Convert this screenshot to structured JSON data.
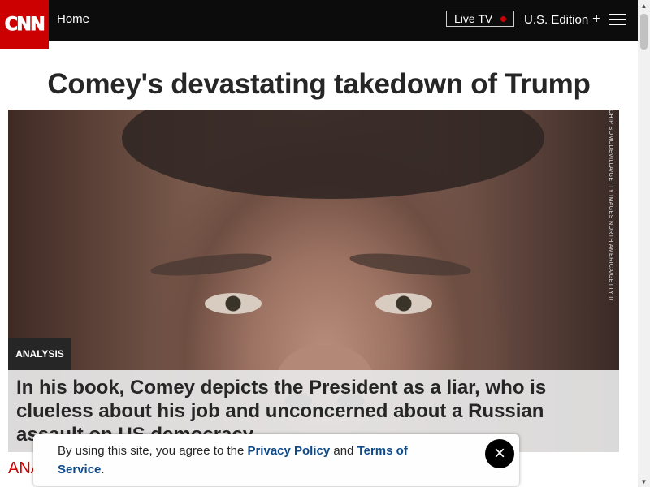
{
  "header": {
    "logo_text": "CNN",
    "nav_home": "Home",
    "live_tv": "Live TV",
    "edition": "U.S. Edition",
    "edition_icon": "+",
    "menu_icon": "hamburger-menu-icon"
  },
  "article": {
    "headline": "Comey's devastating takedown of Trump",
    "image_credit": "CHIP SOMODEVILLA/GETTY IMAGES NORTH AMERICA/GETTY IMAGES",
    "badge": "ANALYSIS",
    "caption": "In his book, Comey depicts the President as a liar, who is clueless about his job and unconcerned about a Russian assault on US democracy",
    "kicker": "ANALYSIS"
  },
  "cookie_banner": {
    "text_before": "By using this site, you agree to the ",
    "privacy_link": "Privacy Policy",
    "text_middle": " and ",
    "terms_link": "Terms of Service",
    "text_after": ".",
    "close_icon": "×"
  },
  "scrollbar": {
    "up_arrow": "▲",
    "down_arrow": "▼"
  },
  "colors": {
    "brand_red": "#cc0000",
    "header_bg": "#0c0c0c",
    "link_blue": "#0c4a8a"
  }
}
